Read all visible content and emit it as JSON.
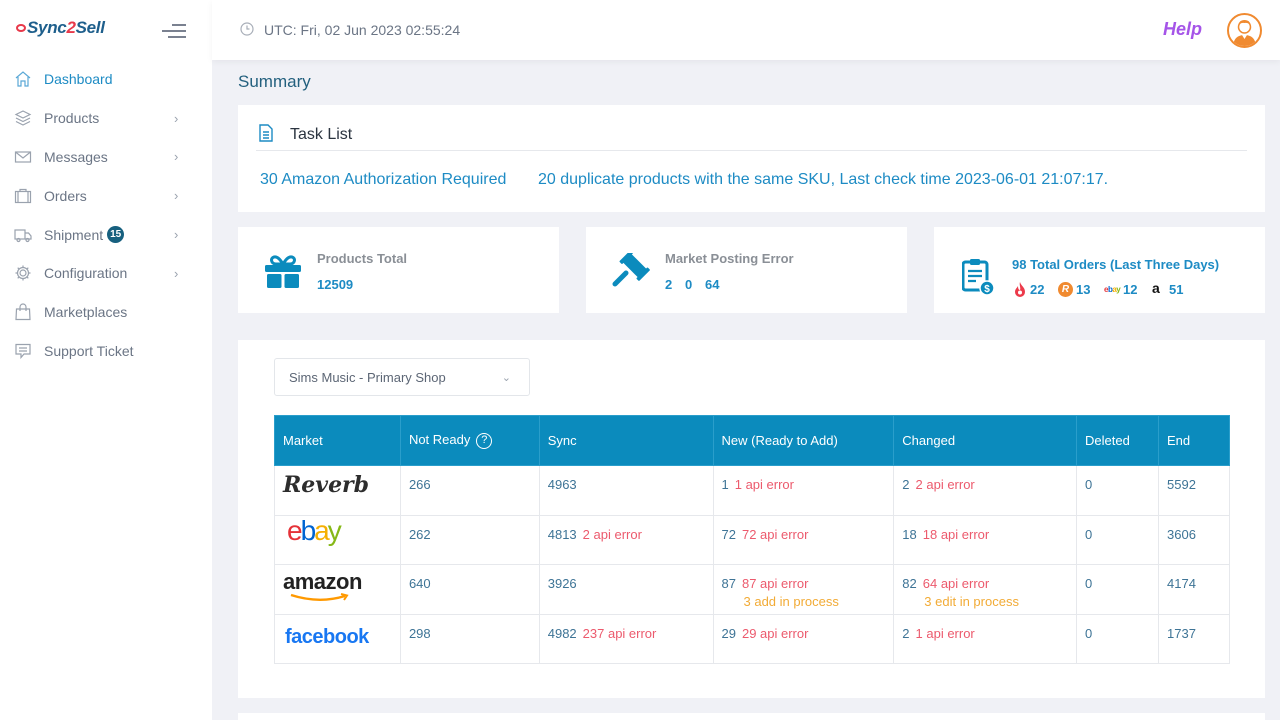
{
  "app": {
    "logo_prefix": "Sync",
    "logo_two": "2",
    "logo_suffix": "Sell"
  },
  "sidebar": {
    "items": [
      {
        "label": "Dashboard",
        "icon": "home-icon",
        "active": true,
        "has_chevron": false
      },
      {
        "label": "Products",
        "icon": "layers-icon",
        "has_chevron": true
      },
      {
        "label": "Messages",
        "icon": "mail-icon",
        "has_chevron": true
      },
      {
        "label": "Orders",
        "icon": "briefcase-icon",
        "has_chevron": true
      },
      {
        "label": "Shipment",
        "icon": "truck-icon",
        "has_chevron": true,
        "badge": "15"
      },
      {
        "label": "Configuration",
        "icon": "gear-icon",
        "has_chevron": true
      },
      {
        "label": "Marketplaces",
        "icon": "shopping-bag-icon",
        "has_chevron": false
      },
      {
        "label": "Support Ticket",
        "icon": "chat-icon",
        "has_chevron": false
      }
    ],
    "chevron": "›"
  },
  "header": {
    "utc": "UTC: Fri, 02 Jun 2023 02:55:24",
    "help": "Help"
  },
  "summary_title": "Summary",
  "task_list": {
    "title": "Task List",
    "links": [
      "30 Amazon Authorization Required",
      "20 duplicate products with the same SKU, Last check time 2023-06-01 21:07:17."
    ]
  },
  "stats": {
    "products_total": {
      "label": "Products Total",
      "value": "12509"
    },
    "market_posting_error": {
      "label": "Market Posting Error",
      "values": [
        "2",
        "0",
        "64"
      ]
    },
    "orders": {
      "label": "98 Total Orders (Last Three Days)",
      "breakdown": [
        {
          "market": "reverb-flame",
          "count": "22"
        },
        {
          "market": "reverb",
          "count": "13"
        },
        {
          "market": "ebay",
          "count": "12"
        },
        {
          "market": "amazon",
          "count": "51"
        }
      ]
    }
  },
  "shop_select": {
    "value": "Sims Music - Primary Shop"
  },
  "table": {
    "headers": [
      "Market",
      "Not Ready",
      "Sync",
      "New (Ready to Add)",
      "Changed",
      "Deleted",
      "End"
    ],
    "rows": [
      {
        "market": "Reverb",
        "not_ready": "266",
        "sync": "4963",
        "sync_err": "",
        "new": "1",
        "new_err": "1 api error",
        "new_proc": "",
        "changed": "2",
        "changed_err": "2 api error",
        "changed_proc": "",
        "deleted": "0",
        "end": "5592"
      },
      {
        "market": "ebay",
        "not_ready": "262",
        "sync": "4813",
        "sync_err": "2 api error",
        "new": "72",
        "new_err": "72 api error",
        "new_proc": "",
        "changed": "18",
        "changed_err": "18 api error",
        "changed_proc": "",
        "deleted": "0",
        "end": "3606"
      },
      {
        "market": "amazon",
        "not_ready": "640",
        "sync": "3926",
        "sync_err": "",
        "new": "87",
        "new_err": "87 api error",
        "new_proc": "3 add in process",
        "changed": "82",
        "changed_err": "64 api error",
        "changed_proc": "3 edit in process",
        "deleted": "0",
        "end": "4174"
      },
      {
        "market": "facebook",
        "not_ready": "298",
        "sync": "4982",
        "sync_err": "237 api error",
        "new": "29",
        "new_err": "29 api error",
        "new_proc": "",
        "changed": "2",
        "changed_err": "1 api error",
        "changed_proc": "",
        "deleted": "0",
        "end": "1737"
      }
    ]
  },
  "colors": {
    "accent": "#1d8bc4",
    "table_header": "#0b8bbd",
    "error": "#ec5a6d",
    "in_process": "#f2ab36",
    "help": "#a554e8",
    "avatar": "#f08a30"
  }
}
